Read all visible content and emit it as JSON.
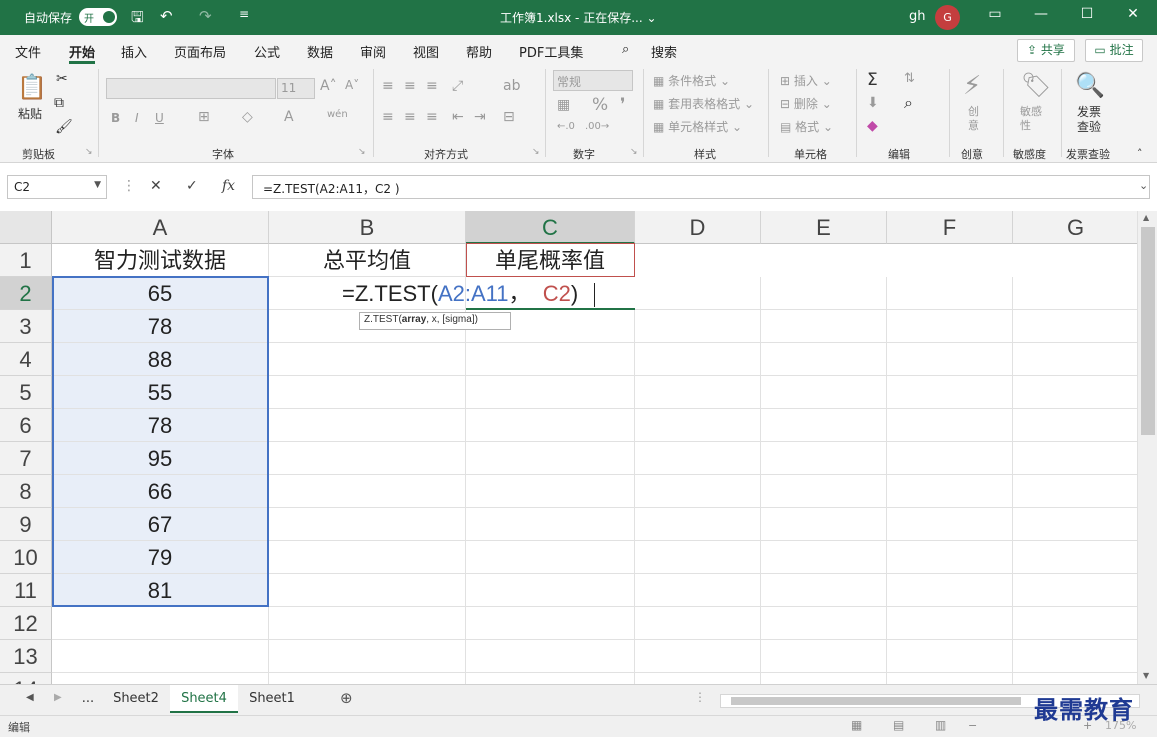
{
  "titlebar": {
    "autosave_label": "自动保存",
    "toggle_label": "开",
    "window_title": "工作簿1.xlsx - 正在保存... ⌄",
    "user": "gh",
    "avatar": "G"
  },
  "tabs": [
    "文件",
    "开始",
    "插入",
    "页面布局",
    "公式",
    "数据",
    "审阅",
    "视图",
    "帮助",
    "PDF工具集",
    "搜索"
  ],
  "share_label": "共享",
  "comment_label": "批注",
  "ribbon": {
    "paste": "粘贴",
    "font_size": "11",
    "number_format": "常规",
    "cond_format": "条件格式",
    "table_format": "套用表格格式",
    "cell_style": "单元格样式",
    "insert": "插入",
    "delete": "删除",
    "format": "格式",
    "creative": "创意",
    "sensitivity": "敏感性",
    "invoice": "发票查验",
    "groups": [
      "剪贴板",
      "字体",
      "对齐方式",
      "数字",
      "样式",
      "单元格",
      "编辑",
      "创意",
      "敏感度",
      "发票查验"
    ]
  },
  "formula_bar": {
    "name_box": "C2",
    "formula": "=Z.TEST(A2:A11，C2 )"
  },
  "columns": [
    "A",
    "B",
    "C",
    "D",
    "E",
    "F",
    "G"
  ],
  "rows": [
    "1",
    "2",
    "3",
    "4",
    "5",
    "6",
    "7",
    "8",
    "9",
    "10",
    "11",
    "12",
    "13",
    "14"
  ],
  "cells": {
    "A1": "智力测试数据",
    "B1": "总平均值",
    "C1": "单尾概率值",
    "A_values": [
      "65",
      "78",
      "88",
      "55",
      "78",
      "95",
      "66",
      "67",
      "79",
      "81"
    ]
  },
  "edit": {
    "prefix": "=Z.TEST(",
    "range_ref": "A2:A11",
    "comma": "，",
    "cell_ref": "C2",
    "suffix": ")",
    "tooltip_fn": "Z.TEST(",
    "tooltip_arg1": "array",
    "tooltip_rest": ", x, [sigma])"
  },
  "sheets": [
    "...",
    "Sheet2",
    "Sheet4",
    "Sheet1"
  ],
  "active_sheet": "Sheet4",
  "status": "编辑",
  "zoom": "175%",
  "watermark": "最需教育",
  "colors": {
    "excel_green": "#217346",
    "range_blue": "#4472c4",
    "ref_red": "#c0504d"
  }
}
